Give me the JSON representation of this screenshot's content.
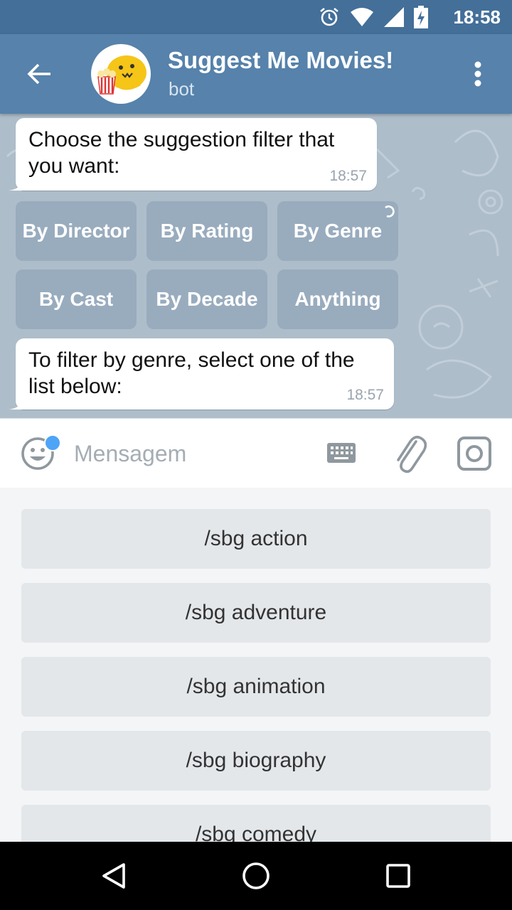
{
  "status_bar": {
    "time": "18:58",
    "icons": [
      "alarm-icon",
      "wifi-icon",
      "signal-icon",
      "battery-charging-icon"
    ]
  },
  "toolbar": {
    "title": "Suggest Me Movies!",
    "subtitle": "bot",
    "back_icon": "arrow-left-icon",
    "menu_icon": "more-vert-icon"
  },
  "messages": [
    {
      "text_line1": "Choose the suggestion filter that",
      "text_line2": "you want:",
      "time": "18:57"
    },
    {
      "text_line1": "To filter by genre, select one of the",
      "text_line2": "list below:",
      "time": "18:57"
    }
  ],
  "inline_keyboard": {
    "row1": [
      "By Director",
      "By Rating",
      "By Genre"
    ],
    "row2": [
      "By Cast",
      "By Decade",
      "Anything"
    ]
  },
  "input": {
    "placeholder": "Mensagem",
    "value": ""
  },
  "reply_keyboard": {
    "buttons": [
      "/sbg action",
      "/sbg adventure",
      "/sbg animation",
      "/sbg biography",
      "/sbg comedy"
    ]
  },
  "colors": {
    "toolbar": "#5682ab",
    "status_bar": "#436f99",
    "chat_bg": "#aebdca",
    "unread_dot": "#4ea4f6"
  }
}
